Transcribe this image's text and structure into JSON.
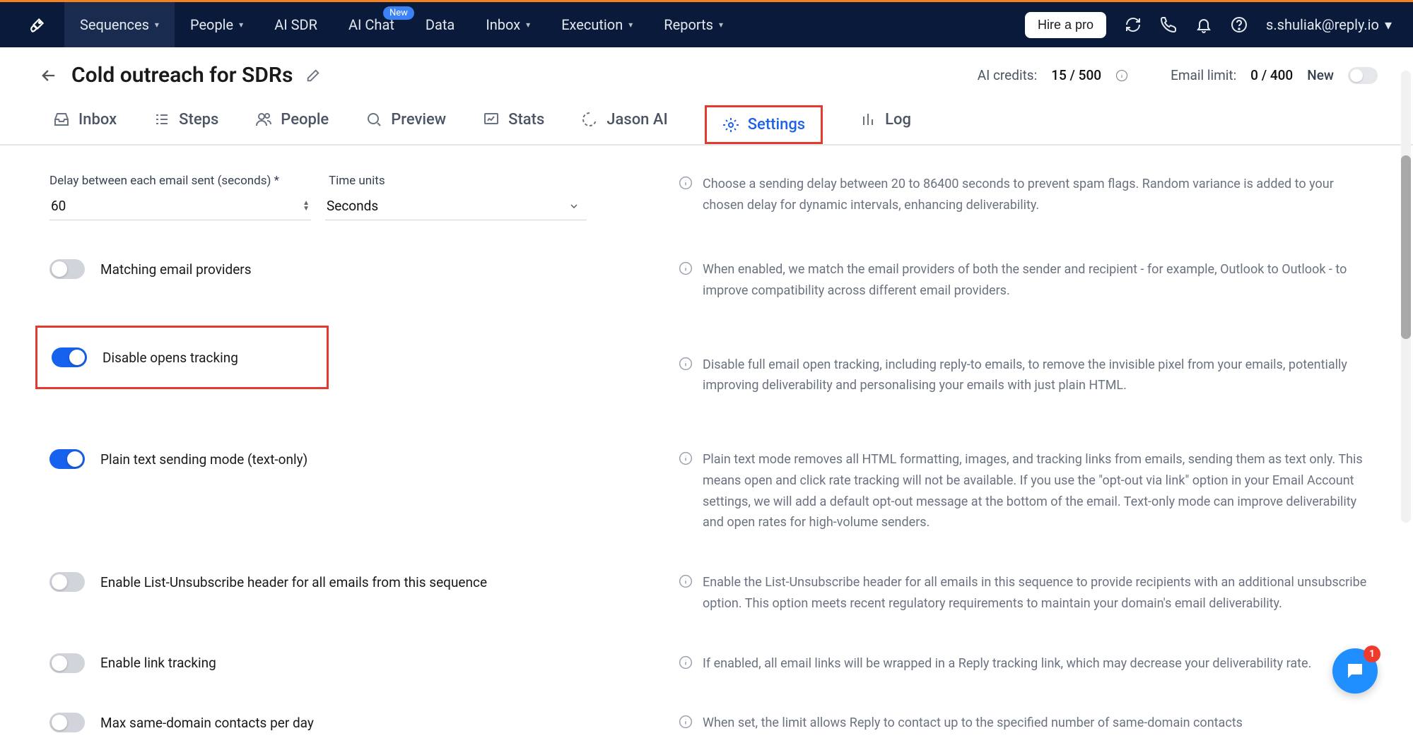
{
  "nav": {
    "items": [
      "Sequences",
      "People",
      "AI SDR",
      "AI Chat",
      "Data",
      "Inbox",
      "Execution",
      "Reports"
    ],
    "new_badge": "New",
    "hire": "Hire a pro",
    "user": "s.shuliak@reply.io"
  },
  "header": {
    "title": "Cold outreach for SDRs",
    "ai_credits_label": "AI credits:",
    "ai_credits_value": "15 / 500",
    "email_limit_label": "Email limit:",
    "email_limit_value": "0 / 400",
    "new_label": "New"
  },
  "tabs": [
    "Inbox",
    "Steps",
    "People",
    "Preview",
    "Stats",
    "Jason AI",
    "Settings",
    "Log"
  ],
  "settings": {
    "delay_label": "Delay between each email sent (seconds)",
    "delay_required": "*",
    "time_units_label": "Time units",
    "delay_value": "60",
    "time_unit_value": "Seconds",
    "delay_help": "Choose a sending delay between 20 to 86400 seconds to prevent spam flags. Random variance is added to your chosen delay for dynamic intervals, enhancing deliverability.",
    "items": [
      {
        "label": "Matching email providers",
        "on": false,
        "help": "When enabled, we match the email providers of both the sender and recipient - for example, Outlook to Outlook - to improve compatibility across different email providers."
      },
      {
        "label": "Disable opens tracking",
        "on": true,
        "help": "Disable full email open tracking, including reply-to emails, to remove the invisible pixel from your emails, potentially improving deliverability and personalising your emails with just plain HTML."
      },
      {
        "label": "Plain text sending mode (text-only)",
        "on": true,
        "help": "Plain text mode removes all HTML formatting, images, and tracking links from emails, sending them as text only. This means open and click rate tracking will not be available. If you use the \"opt-out via link\" option in your Email Account settings, we will add a default opt-out message at the bottom of the email. Text-only mode can improve deliverability and open rates for high-volume senders."
      },
      {
        "label": "Enable List-Unsubscribe header for all emails from this sequence",
        "on": false,
        "help": "Enable the List-Unsubscribe header for all emails in this sequence to provide recipients with an additional unsubscribe option. This option meets recent regulatory requirements to maintain your domain's email deliverability."
      },
      {
        "label": "Enable link tracking",
        "on": false,
        "help": "If enabled, all email links will be wrapped in a Reply tracking link, which may decrease your deliverability rate."
      },
      {
        "label": "Max same-domain contacts per day",
        "on": false,
        "help": "When set, the limit allows Reply to contact up to the specified number of same-domain contacts"
      }
    ]
  },
  "chat_badge": "1"
}
